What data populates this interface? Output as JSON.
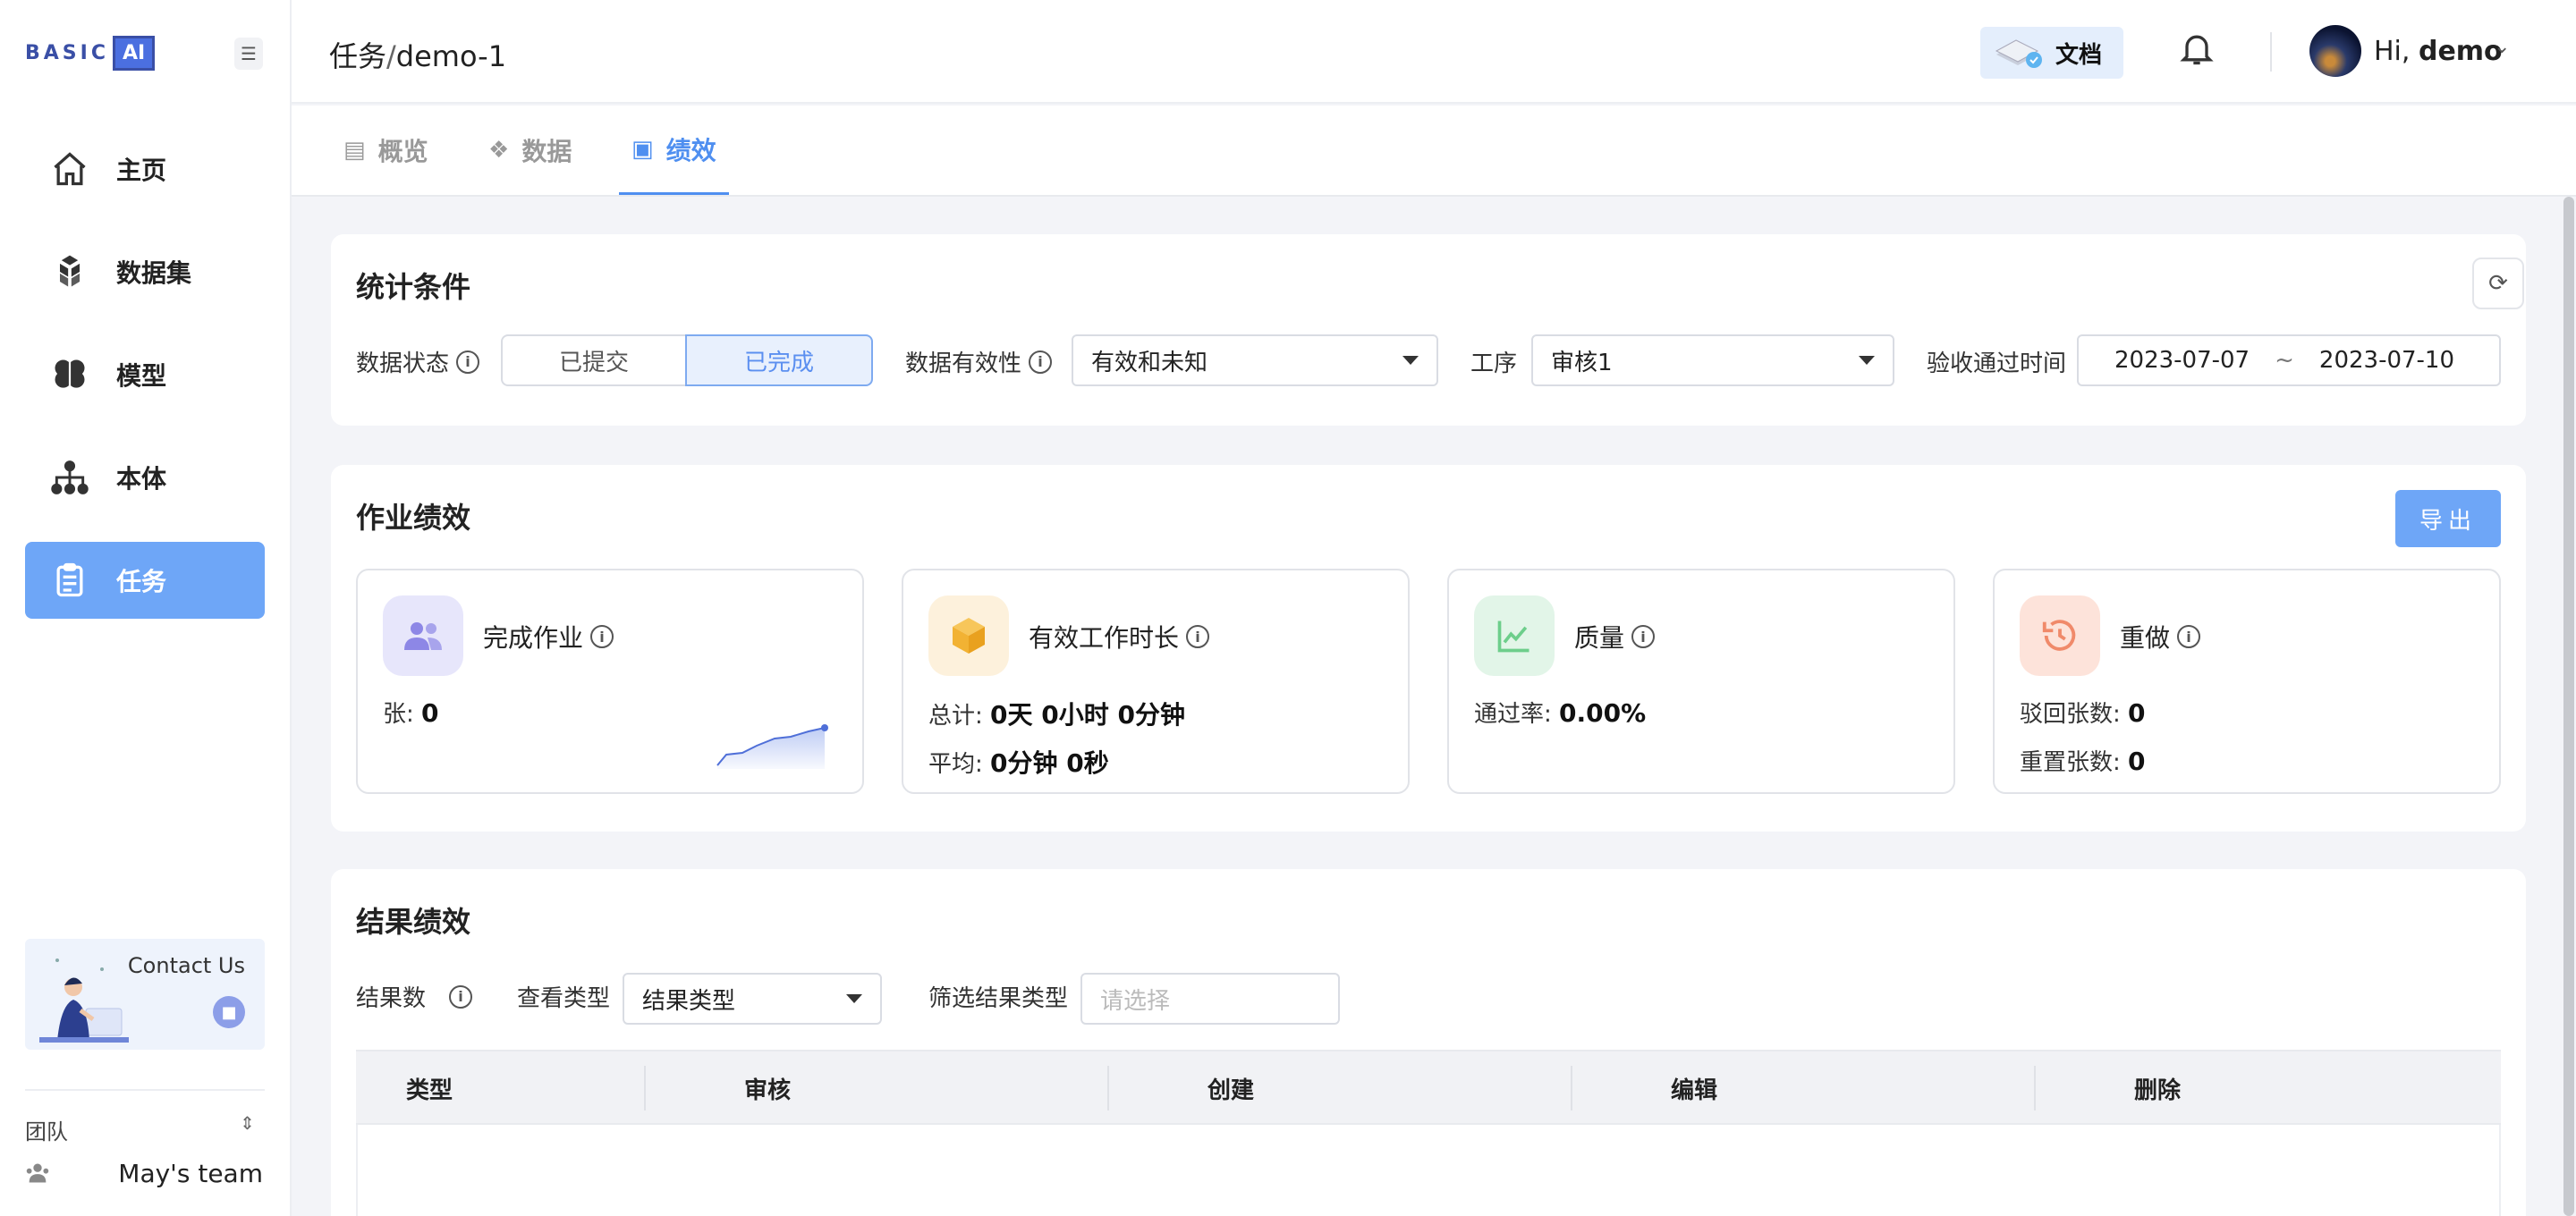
{
  "sidebar": {
    "logo_text": "BASIC",
    "logo_ai": "AI",
    "items": [
      {
        "label": "主页",
        "icon": "home-icon"
      },
      {
        "label": "数据集",
        "icon": "dataset-icon"
      },
      {
        "label": "模型",
        "icon": "brain-icon"
      },
      {
        "label": "本体",
        "icon": "ontology-icon"
      },
      {
        "label": "任务",
        "icon": "task-icon",
        "active": true
      }
    ],
    "contact_label": "Contact Us",
    "team_label": "团队",
    "team_name": "May's team"
  },
  "header": {
    "breadcrumb_root": "任务",
    "breadcrumb_sep": "/",
    "breadcrumb_current": "demo-1",
    "doc_label": "文档",
    "greeting_prefix": "Hi, ",
    "user_name": "demo"
  },
  "tabs": [
    {
      "label": "概览",
      "icon": "overview-icon"
    },
    {
      "label": "数据",
      "icon": "data-icon"
    },
    {
      "label": "绩效",
      "icon": "performance-icon",
      "active": true
    }
  ],
  "filters": {
    "title": "统计条件",
    "data_status_label": "数据状态",
    "status_options": [
      "已提交",
      "已完成"
    ],
    "status_selected": "已完成",
    "validity_label": "数据有效性",
    "validity_value": "有效和未知",
    "stage_label": "工序",
    "stage_value": "审核1",
    "accept_time_label": "验收通过时间",
    "date_start": "2023-07-07",
    "date_sep": "~",
    "date_end": "2023-07-10"
  },
  "work": {
    "title": "作业绩效",
    "export_label": "导出",
    "cards": [
      {
        "title": "完成作业",
        "icon": "users-icon",
        "icon_bg": "#e7e6fb",
        "lines": [
          {
            "label": "张: ",
            "value": "0"
          }
        ]
      },
      {
        "title": "有效工作时长",
        "icon": "box-icon",
        "icon_bg": "#fdf1dc",
        "lines": [
          {
            "label": "总计: ",
            "value": "0天 0小时 0分钟"
          },
          {
            "label": "平均: ",
            "value": "0分钟 0秒"
          }
        ]
      },
      {
        "title": "质量",
        "icon": "chart-line-icon",
        "icon_bg": "#e2f5e8",
        "lines": [
          {
            "label": "通过率: ",
            "value": "0.00%"
          }
        ]
      },
      {
        "title": "重做",
        "icon": "history-icon",
        "icon_bg": "#fde3da",
        "lines": [
          {
            "label": "驳回张数: ",
            "value": "0"
          },
          {
            "label": "重置张数: ",
            "value": "0"
          }
        ]
      }
    ]
  },
  "results": {
    "title": "结果绩效",
    "count_label": "结果数",
    "view_type_label": "查看类型",
    "view_type_value": "结果类型",
    "filter_label": "筛选结果类型",
    "filter_placeholder": "请选择",
    "columns": [
      "类型",
      "审核",
      "创建",
      "编辑",
      "删除"
    ]
  },
  "colors": {
    "accent": "#6ea6f7",
    "tab_active": "#4f8ff0"
  }
}
